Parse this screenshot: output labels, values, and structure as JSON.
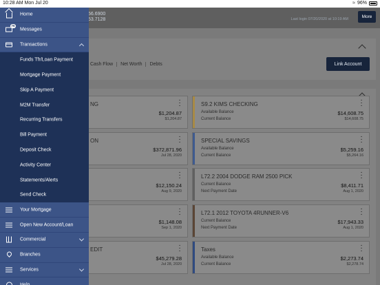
{
  "status_bar": {
    "time": "10:28 AM  Mon Jul 20",
    "battery": "96%"
  },
  "header": {
    "num1": "56.6900",
    "num2": "53.7128",
    "last_login": "Last login 07/20/2020 at 10:19 AM",
    "more_label": "More"
  },
  "summary_tabs": [
    "Cash Flow",
    "Net Worth",
    "Debts"
  ],
  "link_account_label": "Link Account",
  "accounts": [
    {
      "name": "NG",
      "label1": "",
      "label2": "",
      "amount": "$1,204.87",
      "sub": "$1,204.87",
      "strip": "#7a7a7a"
    },
    {
      "name": "S9.2 KIMS CHECKING",
      "label1": "Available Balance",
      "label2": "Current Balance",
      "amount": "$14,608.75",
      "sub": "$14,608.75",
      "strip": "#a88a45"
    },
    {
      "name": "ON",
      "label1": "",
      "label2": "",
      "amount": "$372,871.96",
      "sub": "Jul 28, 2020",
      "strip": "#7a7a7a"
    },
    {
      "name": "SPECIAL SAVINGS",
      "label1": "Available Balance",
      "label2": "Current Balance",
      "amount": "$5,259.16",
      "sub": "$5,264.16",
      "strip": "#3e5a8f"
    },
    {
      "name": "",
      "label1": "",
      "label2": "",
      "amount": "$12,150.24",
      "sub": "Aug 9, 2020",
      "strip": "#7a7a7a"
    },
    {
      "name": "L72.2 2004 DODGE RAM 2500 PICK",
      "label1": "Current Balance",
      "label2": "Next Payment Date",
      "amount": "$8,411.71",
      "sub": "Aug 1, 2020",
      "strip": "#606060"
    },
    {
      "name": "",
      "label1": "",
      "label2": "",
      "amount": "$1,148.08",
      "sub": "Sep 1, 2020",
      "strip": "#7a7a7a"
    },
    {
      "name": "L72.1 2012 TOYOTA 4RUNNER-V6",
      "label1": "Current Balance",
      "label2": "Next Payment Date",
      "amount": "$17,943.33",
      "sub": "Aug 1, 2020",
      "strip": "#5a4535"
    },
    {
      "name": "EDIT",
      "label1": "",
      "label2": "",
      "amount": "$45,279.28",
      "sub": "Jul 28, 2020",
      "strip": "#7a7a7a"
    },
    {
      "name": "Taxes",
      "label1": "Available Balance",
      "label2": "Current Balance",
      "amount": "$2,273.74",
      "sub": "$2,278.74",
      "strip": "#2f4a80"
    }
  ],
  "menu": [
    {
      "type": "top",
      "label": "Home",
      "icon": "home-icon",
      "chevron": ""
    },
    {
      "type": "top",
      "label": "Messages",
      "icon": "mail-icon",
      "chevron": "",
      "badge": "76"
    },
    {
      "type": "top",
      "label": "Transactions",
      "icon": "credit-card-icon",
      "chevron": "up"
    },
    {
      "type": "sub",
      "label": "Funds Tfr/Loan Payment"
    },
    {
      "type": "sub",
      "label": "Mortgage Payment"
    },
    {
      "type": "sub",
      "label": "Skip A Payment"
    },
    {
      "type": "sub",
      "label": "M2M Transfer"
    },
    {
      "type": "sub",
      "label": "Recurring Transfers"
    },
    {
      "type": "sub",
      "label": "Bill Payment"
    },
    {
      "type": "sub",
      "label": "Deposit Check"
    },
    {
      "type": "sub",
      "label": "Activity Center"
    },
    {
      "type": "sub",
      "label": "Statements/Alerts"
    },
    {
      "type": "sub",
      "label": "Send Check"
    },
    {
      "type": "top",
      "label": "Your Mortgage",
      "icon": "list-icon",
      "chevron": ""
    },
    {
      "type": "top",
      "label": "Open New Account/Loan",
      "icon": "list-icon",
      "chevron": ""
    },
    {
      "type": "top",
      "label": "Commercial",
      "icon": "bank-icon",
      "chevron": "down"
    },
    {
      "type": "top",
      "label": "Branches",
      "icon": "location-pin-icon",
      "chevron": ""
    },
    {
      "type": "top",
      "label": "Services",
      "icon": "list-icon",
      "chevron": "down"
    },
    {
      "type": "top",
      "label": "Help",
      "icon": "help-icon",
      "chevron": ""
    }
  ],
  "colors": {
    "drawer": "#24375b",
    "drawer_top_item": "#3c5487",
    "accent_button": "#17243b"
  }
}
